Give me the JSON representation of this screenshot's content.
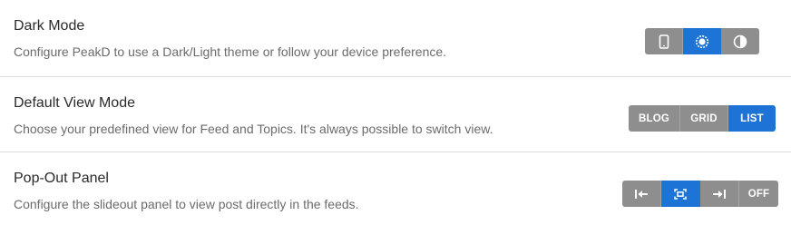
{
  "settings": {
    "dark_mode": {
      "title": "Dark Mode",
      "description": "Configure PeakD to use a Dark/Light theme or follow your device preference.",
      "options": [
        {
          "icon": "mobile-icon",
          "active": false
        },
        {
          "icon": "sun-icon",
          "active": true
        },
        {
          "icon": "half-circle-icon",
          "active": false
        }
      ]
    },
    "default_view_mode": {
      "title": "Default View Mode",
      "description": "Choose your predefined view for Feed and Topics. It's always possible to switch view.",
      "options": [
        {
          "label": "BLOG",
          "active": false
        },
        {
          "label": "GRID",
          "active": false
        },
        {
          "label": "LIST",
          "active": true
        }
      ]
    },
    "pop_out_panel": {
      "title": "Pop-Out Panel",
      "description": "Configure the slideout panel to view post directly in the feeds.",
      "options": [
        {
          "icon": "panel-left-icon",
          "active": false
        },
        {
          "icon": "panel-center-icon",
          "active": true
        },
        {
          "icon": "panel-right-icon",
          "active": false
        },
        {
          "label": "OFF",
          "active": false
        }
      ]
    }
  },
  "colors": {
    "active": "#1e74d6",
    "inactive": "#8e8e8e",
    "divider": "#dcdcdc"
  }
}
